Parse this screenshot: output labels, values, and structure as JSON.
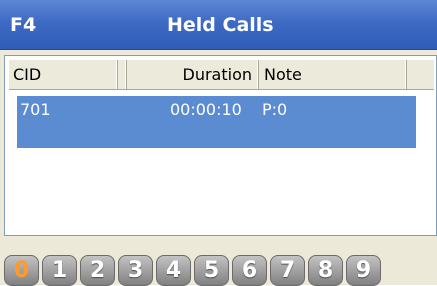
{
  "window": {
    "fkey": "F4",
    "title": "Held Calls"
  },
  "table": {
    "columns": [
      "CID",
      "Duration",
      "Note"
    ],
    "rows": [
      {
        "cid": "701",
        "duration": "00:00:10",
        "note": "P:0",
        "selected": true
      }
    ]
  },
  "number_bar": {
    "buttons": [
      "0",
      "1",
      "2",
      "3",
      "4",
      "5",
      "6",
      "7",
      "8",
      "9"
    ],
    "active": "0"
  },
  "colors": {
    "title_bar": "#3e6ac4",
    "selected_row": "#5b8cd2",
    "active_number": "#ff9a2e"
  }
}
